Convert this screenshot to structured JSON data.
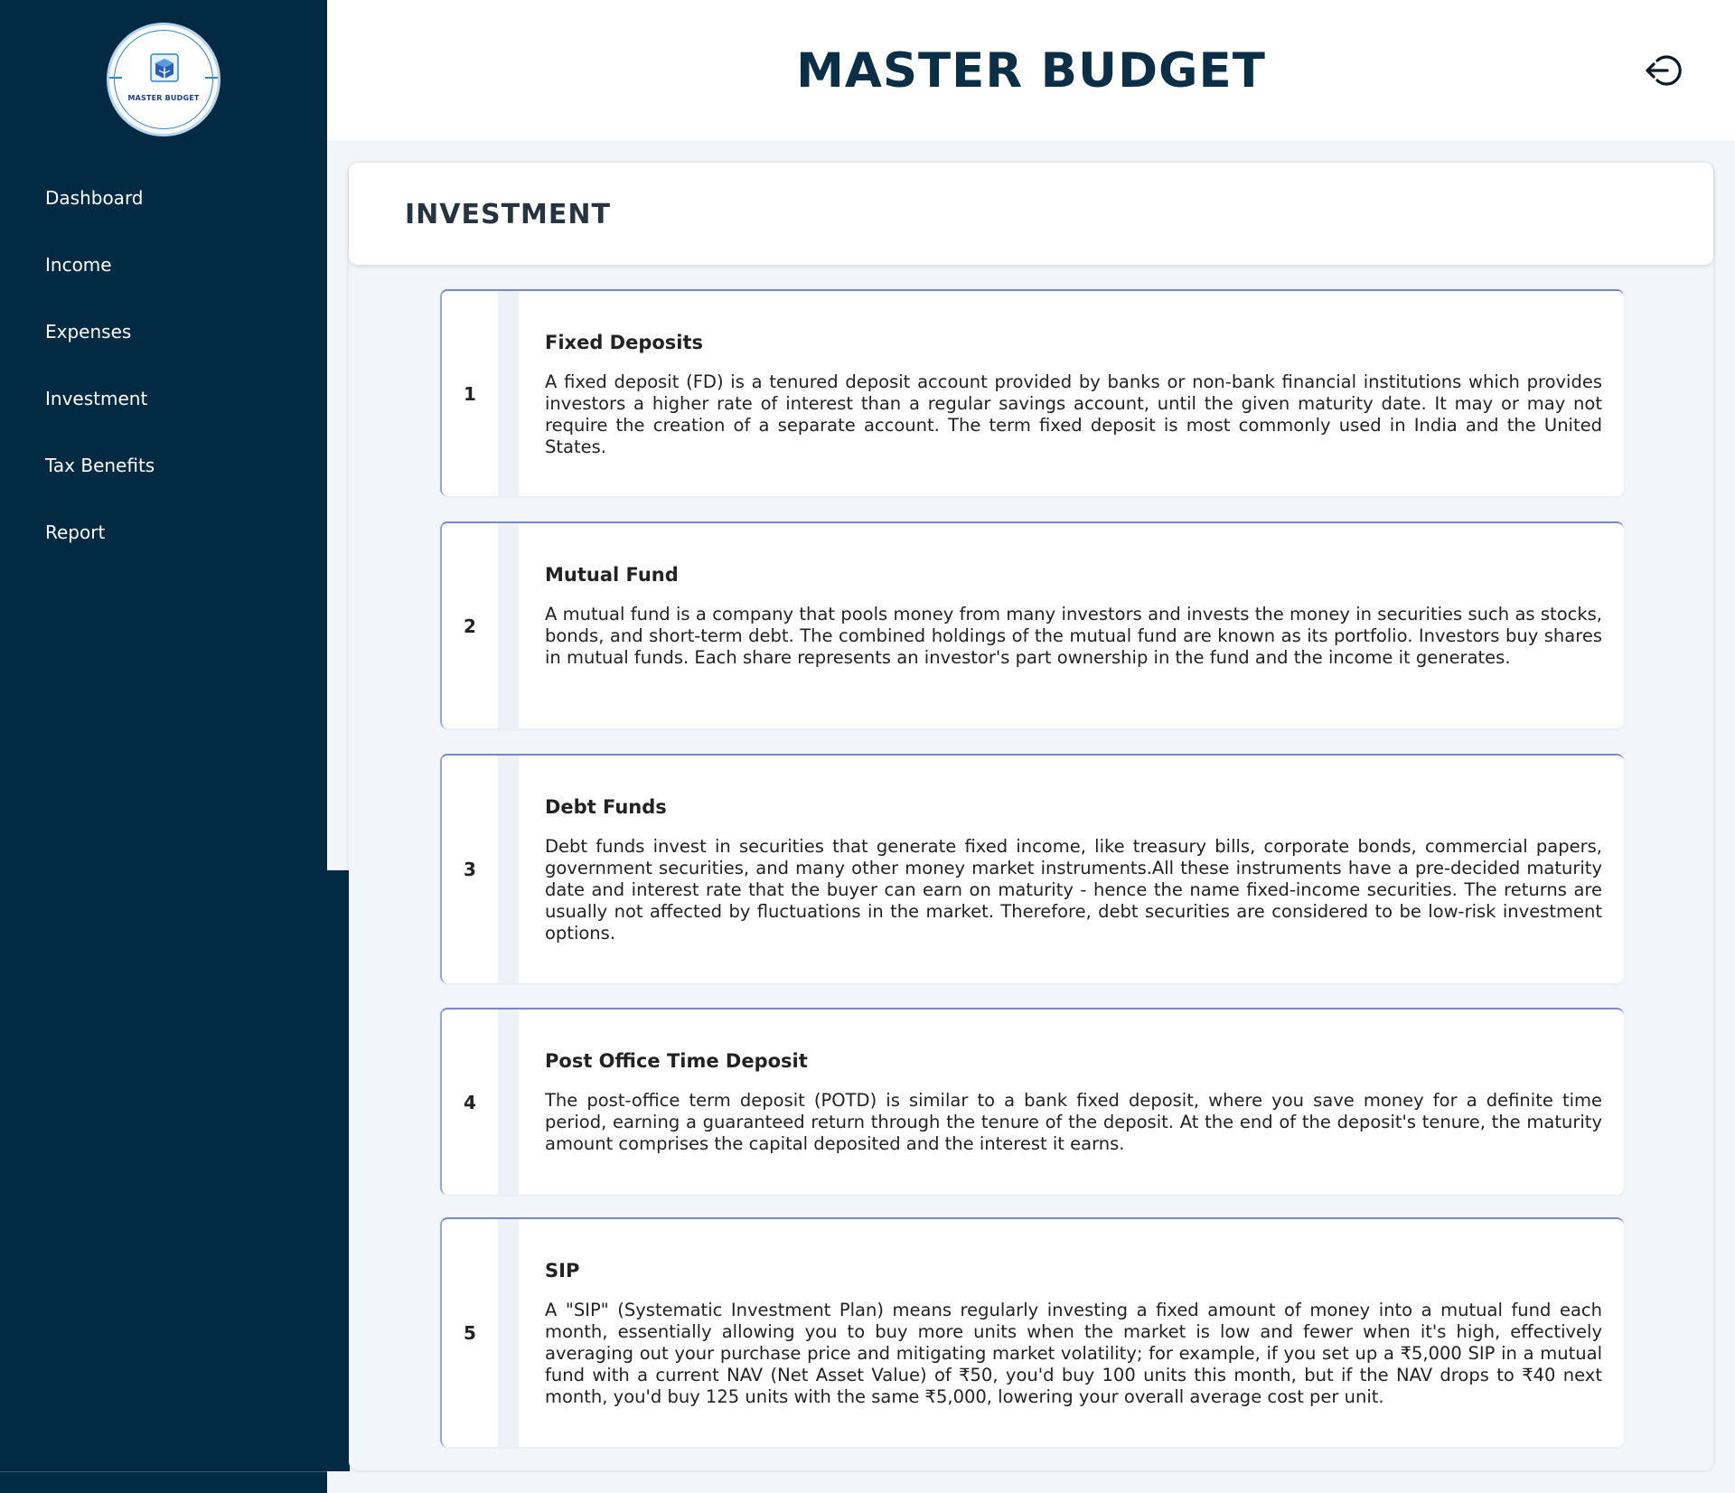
{
  "brand": {
    "logo_text": "MASTER BUDGET"
  },
  "header": {
    "title": "MASTER BUDGET",
    "logout_icon": "logout-icon"
  },
  "sidebar": {
    "items": [
      {
        "label": "Dashboard"
      },
      {
        "label": "Income"
      },
      {
        "label": "Expenses"
      },
      {
        "label": "Investment"
      },
      {
        "label": "Tax Benefits"
      },
      {
        "label": "Report"
      }
    ]
  },
  "main": {
    "section_title": "INVESTMENT",
    "investments": [
      {
        "number": "1",
        "title": "Fixed Deposits",
        "description": "A fixed deposit (FD) is a tenured deposit account provided by banks or non-bank financial institutions which provides investors a higher rate of interest than a regular savings account, until the given maturity date. It may or may not require the creation of a separate account. The term fixed deposit is most commonly used in India and the United States."
      },
      {
        "number": "2",
        "title": "Mutual Fund",
        "description": "A mutual fund is a company that pools money from many investors and invests the money in securities such as stocks, bonds, and short-term debt. The combined holdings of the mutual fund are known as its portfolio. Investors buy shares in mutual funds. Each share represents an investor's part ownership in the fund and the income it generates."
      },
      {
        "number": "3",
        "title": "Debt Funds",
        "description": "Debt funds invest in securities that generate fixed income, like treasury bills, corporate bonds, commercial papers, government securities, and many other money market instruments.All these instruments have a pre-decided maturity date and interest rate that the buyer can earn on maturity - hence the name fixed-income securities. The returns are usually not affected by fluctuations in the market. Therefore, debt securities are considered to be low-risk investment options."
      },
      {
        "number": "4",
        "title": "Post Office Time Deposit",
        "description": "The post-office term deposit (POTD) is similar to a bank fixed deposit, where you save money for a definite time period, earning a guaranteed return through the tenure of the deposit. At the end of the deposit's tenure, the maturity amount comprises the capital deposited and the interest it earns."
      },
      {
        "number": "5",
        "title": "SIP",
        "description": "A \"SIP\" (Systematic Investment Plan) means regularly investing a fixed amount of money into a mutual fund each month, essentially allowing you to buy more units when the market is low and fewer when it's high, effectively averaging out your purchase price and mitigating market volatility; for example, if you set up a ₹5,000 SIP in a mutual fund with a current NAV (Net Asset Value) of ₹50, you'd buy 100 units this month, but if the NAV drops to ₹40 next month, you'd buy 125 units with the same ₹5,000, lowering your overall average cost per unit."
      }
    ]
  }
}
